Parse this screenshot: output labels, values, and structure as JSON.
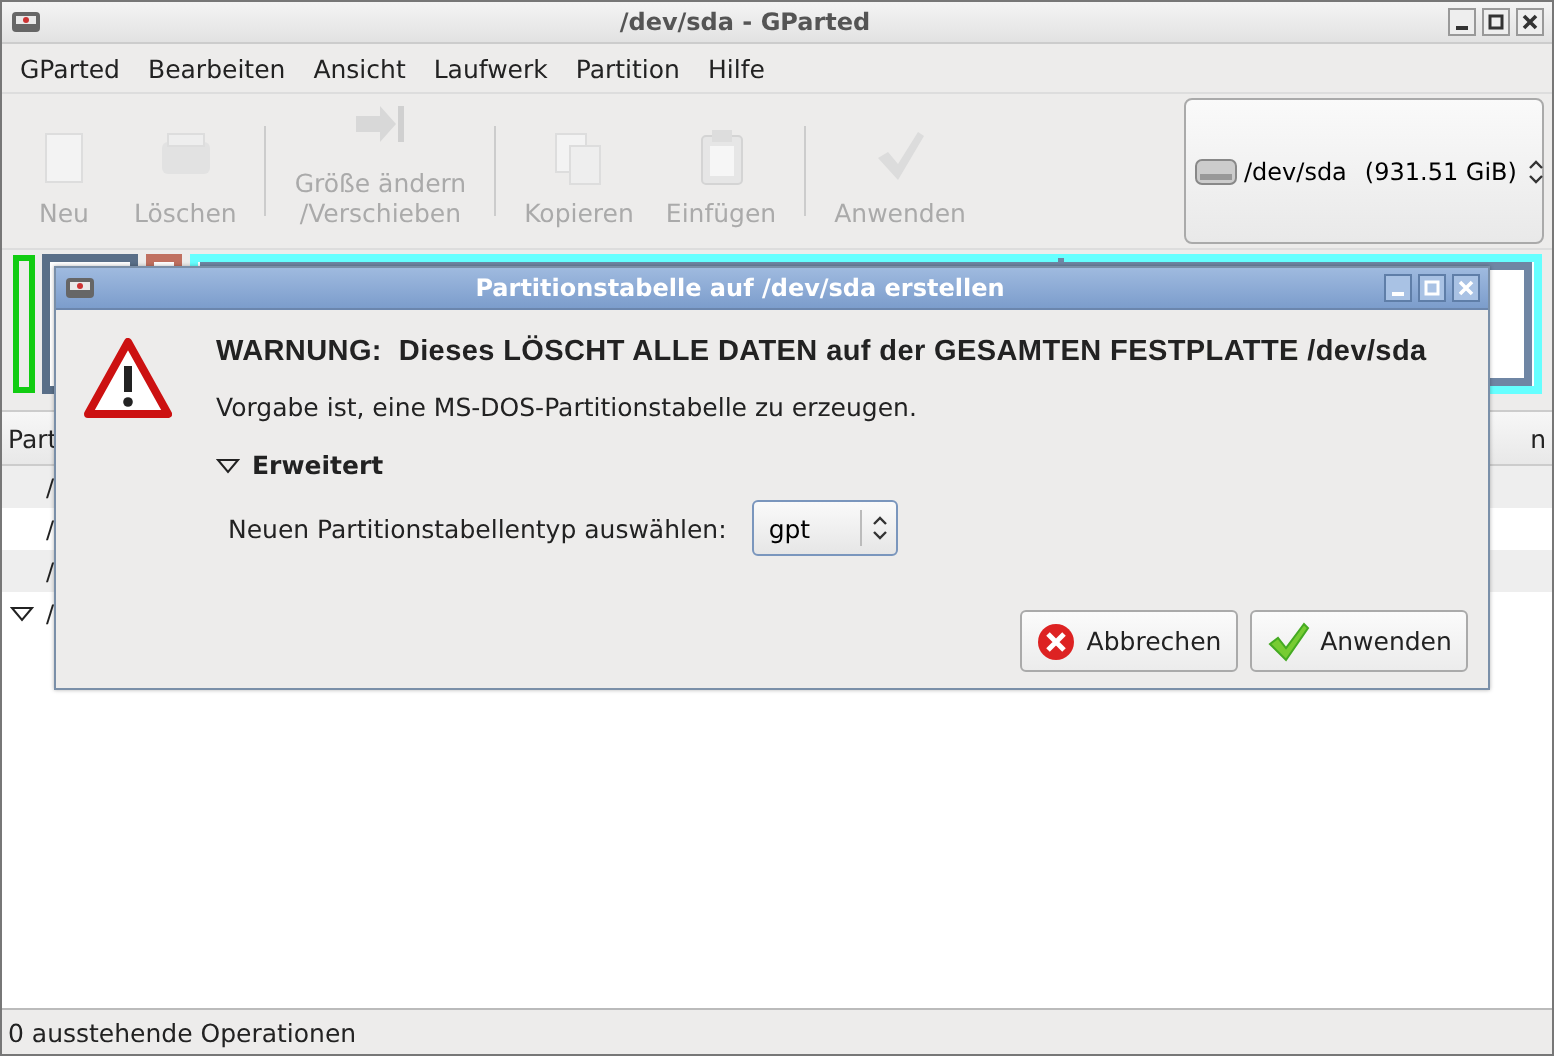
{
  "window": {
    "title": "/dev/sda - GParted"
  },
  "menu": [
    "GParted",
    "Bearbeiten",
    "Ansicht",
    "Laufwerk",
    "Partition",
    "Hilfe"
  ],
  "toolbar": [
    {
      "kind": "new",
      "label": "Neu",
      "disabled": true
    },
    {
      "kind": "delete",
      "label": "Löschen",
      "disabled": true
    },
    {
      "kind": "separator"
    },
    {
      "kind": "resize",
      "label": "Größe ändern\n/Verschieben",
      "disabled": true
    },
    {
      "kind": "separator"
    },
    {
      "kind": "copy",
      "label": "Kopieren",
      "disabled": true
    },
    {
      "kind": "paste",
      "label": "Einfügen",
      "disabled": true
    },
    {
      "kind": "separator"
    },
    {
      "kind": "apply",
      "label": "Anwenden",
      "disabled": true
    }
  ],
  "device_selector": {
    "device": "/dev/sda",
    "size": "(931.51 GiB)"
  },
  "table": {
    "columns": [
      "Part",
      "n"
    ],
    "rows": [
      {
        "kind": "leaf",
        "cell": "/"
      },
      {
        "kind": "leaf",
        "cell": "/"
      },
      {
        "kind": "leaf",
        "cell": "/"
      },
      {
        "kind": "group",
        "cell": "/"
      }
    ]
  },
  "status_bar": "0 ausstehende Operationen",
  "dialog": {
    "title": "Partitionstabelle auf /dev/sda erstellen",
    "heading": "WARNUNG:  Dieses LÖSCHT ALLE DATEN auf der GESAMTEN FESTPLATTE /dev/sda",
    "message": "Vorgabe ist, eine MS-DOS-Partitionstabelle zu erzeugen.",
    "expander": {
      "label": "Erweitert",
      "expanded": true
    },
    "field_label": "Neuen Partitionstabellentyp auswählen:",
    "combo_value": "gpt",
    "buttons": [
      {
        "kind": "cancel",
        "label": "Abbrechen"
      },
      {
        "kind": "apply",
        "label": "Anwenden"
      }
    ]
  }
}
